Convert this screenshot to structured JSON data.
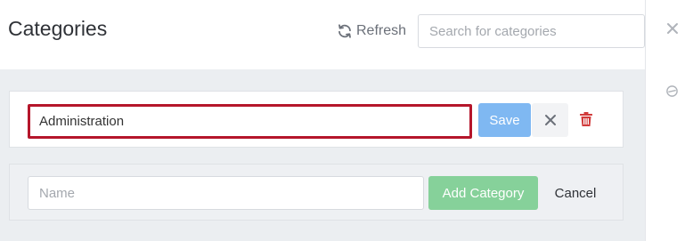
{
  "header": {
    "title": "Categories",
    "refresh_label": "Refresh",
    "search_placeholder": "Search for categories"
  },
  "edit_row": {
    "value": "Administration",
    "save_label": "Save"
  },
  "add_row": {
    "name_placeholder": "Name",
    "add_label": "Add Category",
    "cancel_label": "Cancel"
  },
  "colors": {
    "save": "#7fb8f2",
    "add": "#86d19a",
    "edit_border": "#b5162b",
    "delete": "#d13b3b",
    "background": "#ebeef1"
  }
}
